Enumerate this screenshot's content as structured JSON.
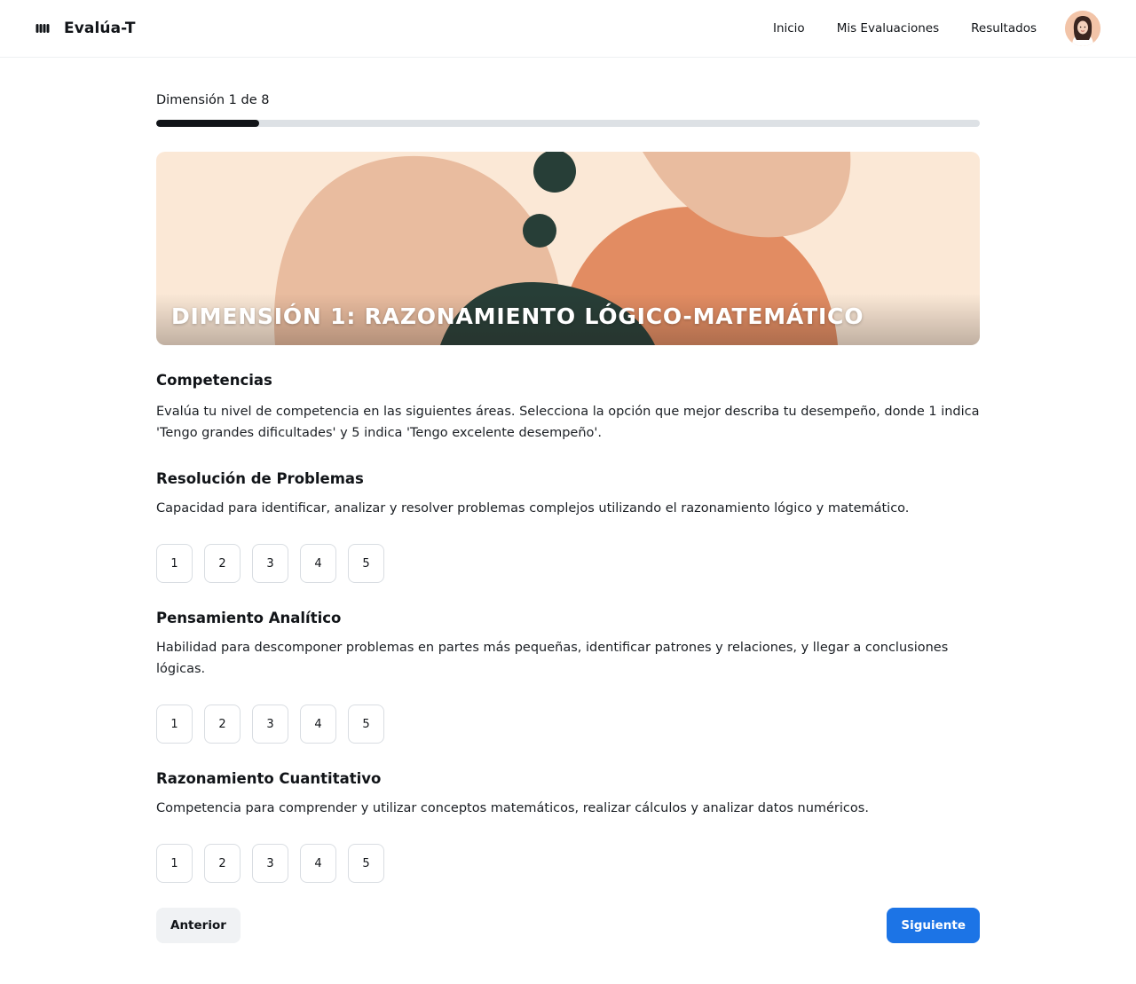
{
  "header": {
    "brand_name": "Evalúa-T",
    "logo_icon": "bars-logo-icon",
    "nav": [
      {
        "label": "Inicio"
      },
      {
        "label": "Mis Evaluaciones"
      },
      {
        "label": "Resultados"
      }
    ],
    "avatar_icon": "user-avatar"
  },
  "progress": {
    "label": "Dimensión 1 de 8",
    "current": 1,
    "total": 8
  },
  "hero": {
    "title": "DIMENSIÓN 1: RAZONAMIENTO LÓGICO-MATEMÁTICO"
  },
  "competencias": {
    "heading": "Competencias",
    "intro": "Evalúa tu nivel de competencia en las siguientes áreas. Selecciona la opción que mejor describa tu desempeño, donde 1 indica 'Tengo grandes dificultades' y 5 indica 'Tengo excelente desempeño'."
  },
  "items": [
    {
      "title": "Resolución de Problemas",
      "description": "Capacidad para identificar, analizar y resolver problemas complejos utilizando el razonamiento lógico y matemático.",
      "options": [
        "1",
        "2",
        "3",
        "4",
        "5"
      ]
    },
    {
      "title": "Pensamiento Analítico",
      "description": "Habilidad para descomponer problemas en partes más pequeñas, identificar patrones y relaciones, y llegar a conclusiones lógicas.",
      "options": [
        "1",
        "2",
        "3",
        "4",
        "5"
      ]
    },
    {
      "title": "Razonamiento Cuantitativo",
      "description": "Competencia para comprender y utilizar conceptos matemáticos, realizar cálculos y analizar datos numéricos.",
      "options": [
        "1",
        "2",
        "3",
        "4",
        "5"
      ]
    }
  ],
  "actions": {
    "prev_label": "Anterior",
    "next_label": "Siguiente"
  },
  "colors": {
    "primary": "#1c74e6",
    "progress_fill": "#111418",
    "progress_track": "#dde1e5",
    "hero_orange": "#e28c62",
    "hero_peach": "#e9bc9f",
    "hero_dark_green": "#273e37",
    "hero_background": "#fbe8d6"
  }
}
